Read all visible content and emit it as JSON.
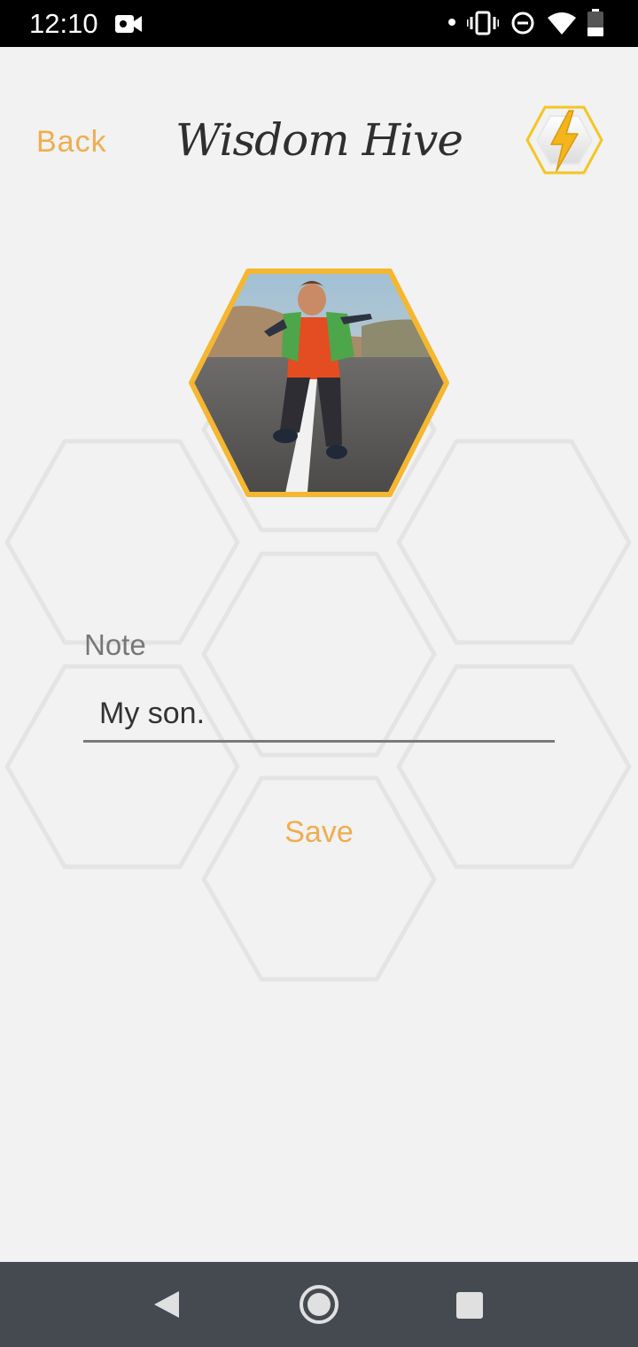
{
  "status_bar": {
    "time": "12:10",
    "icons": [
      "video-camera-icon",
      "notification-dot-icon",
      "vibrate-icon",
      "do-not-disturb-icon",
      "wifi-icon",
      "battery-icon"
    ]
  },
  "header": {
    "back_label": "Back",
    "title": "Wisdom Hive",
    "action_icon": "lightning-bolt-icon"
  },
  "photo": {
    "description_icon": "profile-photo"
  },
  "form": {
    "note_label": "Note",
    "note_value": "My son.",
    "save_label": "Save"
  },
  "nav": {
    "buttons": [
      "back-triangle-icon",
      "home-circle-icon",
      "recents-square-icon"
    ]
  },
  "colors": {
    "accent": "#f0ad4e",
    "background": "#f2f2f2",
    "hex_outline": "#e4e4e4",
    "nav_bg": "#454a50"
  }
}
